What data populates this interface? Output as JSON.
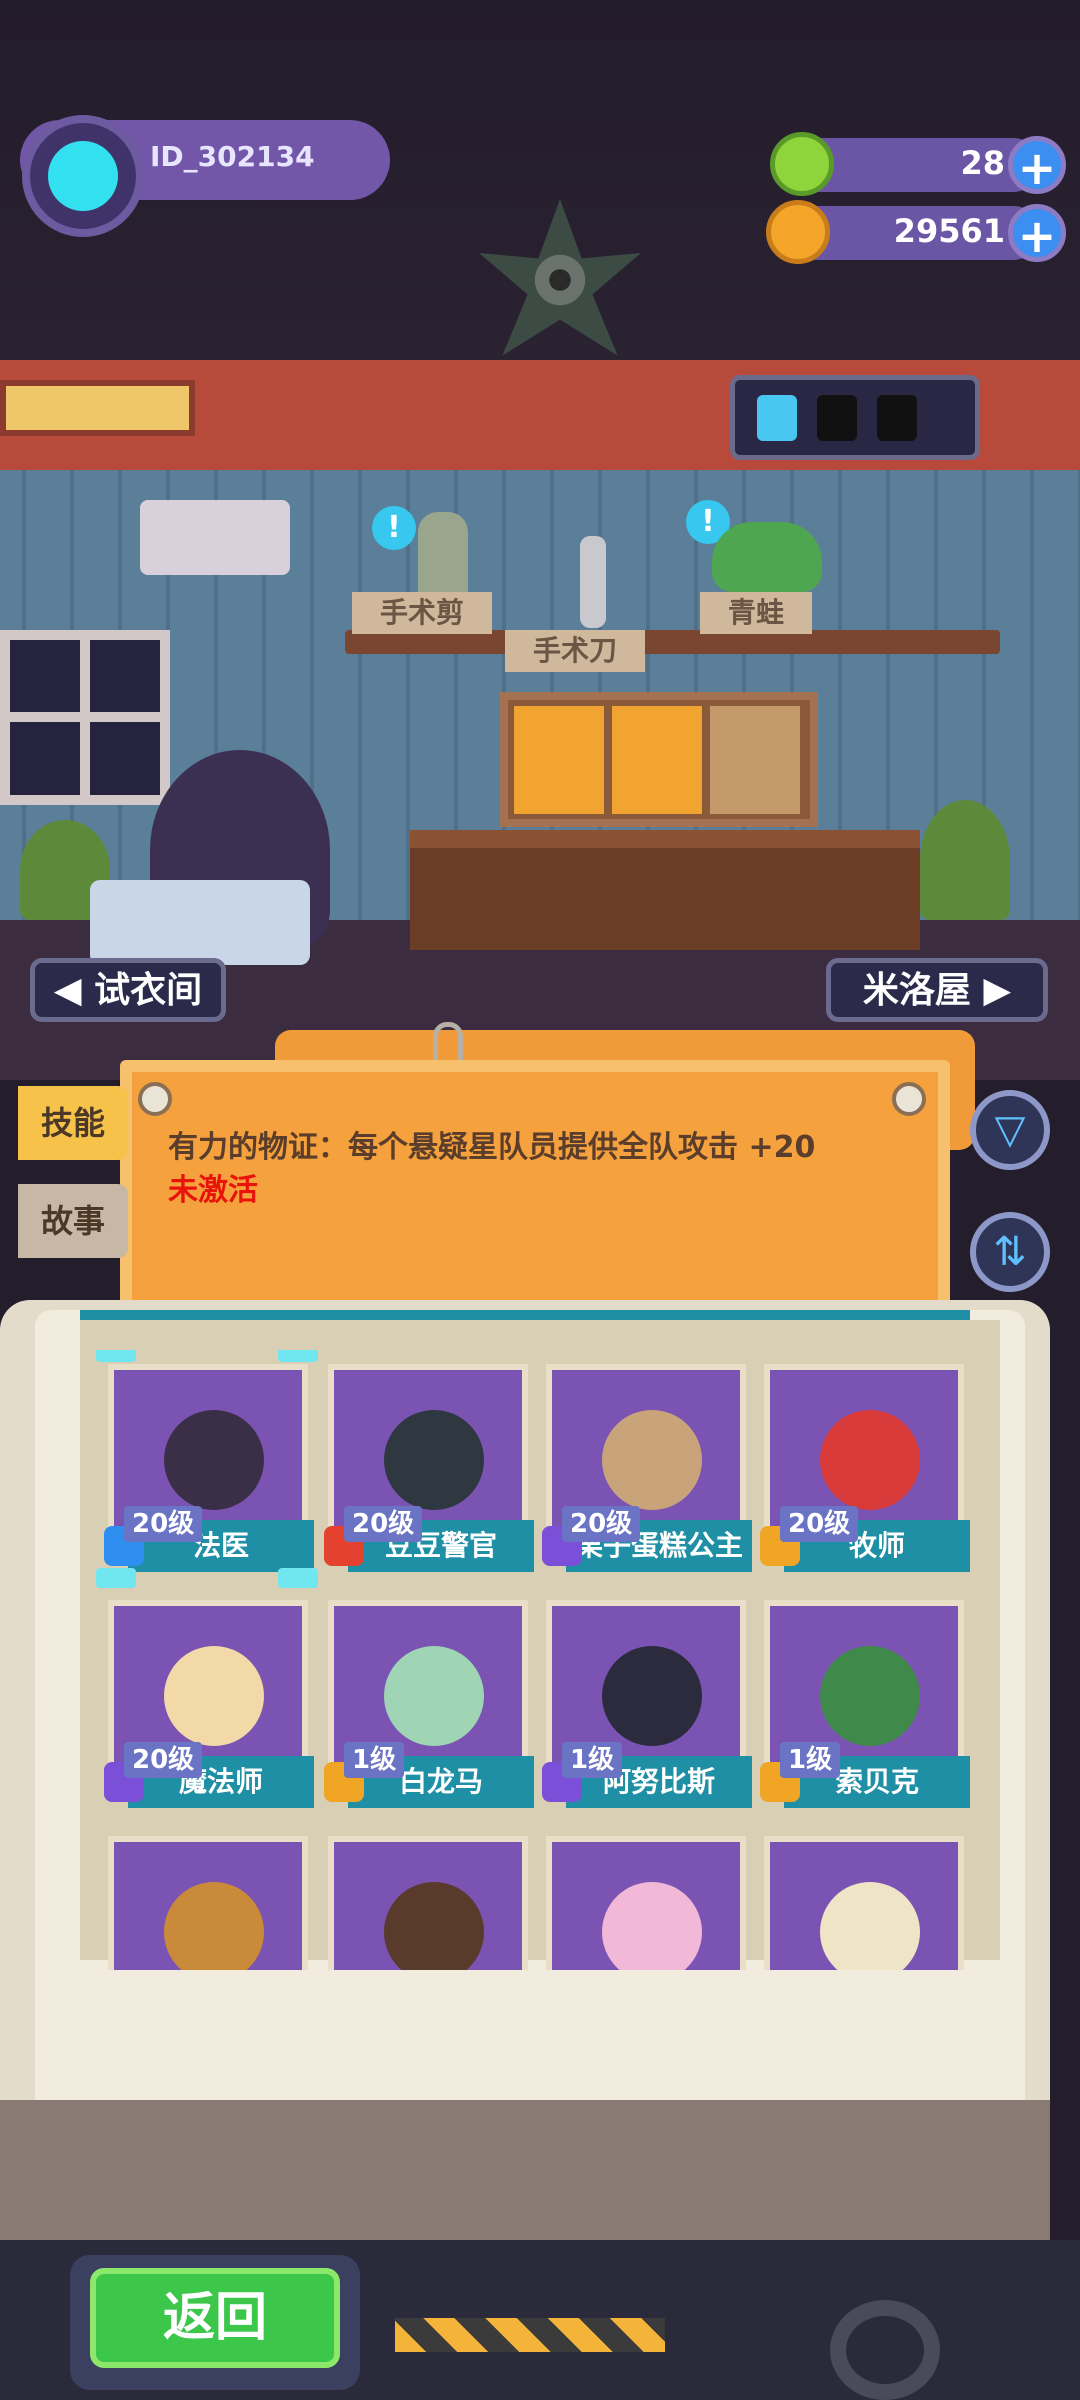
{
  "player": {
    "id": "ID_302134"
  },
  "resources": [
    {
      "name": "green-gem",
      "value": "28",
      "color": "#8fd43a"
    },
    {
      "name": "gold-coin",
      "value": "29561",
      "color": "#f4a52a"
    }
  ],
  "room": {
    "items": [
      "手术剪",
      "手术刀",
      "青蛙"
    ],
    "nav_left": "试衣间",
    "nav_right": "米洛屋"
  },
  "skill_panel": {
    "tabs": [
      "技能",
      "故事"
    ],
    "description": "有力的物证：每个悬疑星队员提供全队攻击 +20",
    "status": "未激活"
  },
  "characters": [
    {
      "level": "20级",
      "name": "法医",
      "emblem_color": "#2f8ff0",
      "face_color": "#3b2f47",
      "selected": true
    },
    {
      "level": "20级",
      "name": "豆豆警官",
      "emblem_color": "#e4412f",
      "face_color": "#2f3740",
      "selected": false
    },
    {
      "level": "20级",
      "name": "栗子蛋糕公主",
      "emblem_color": "#7b4fd8",
      "face_color": "#c9a47a",
      "selected": false
    },
    {
      "level": "20级",
      "name": "牧师",
      "emblem_color": "#f0a525",
      "face_color": "#d83a3a",
      "selected": false
    },
    {
      "level": "20级",
      "name": "魔法师",
      "emblem_color": "#7b4fd8",
      "face_color": "#f3d9a8",
      "selected": false
    },
    {
      "level": "1级",
      "name": "白龙马",
      "emblem_color": "#f0a525",
      "face_color": "#9fd4b5",
      "selected": false
    },
    {
      "level": "1级",
      "name": "阿努比斯",
      "emblem_color": "#7b4fd8",
      "face_color": "#2c2b3e",
      "selected": false
    },
    {
      "level": "1级",
      "name": "索贝克",
      "emblem_color": "#f0a525",
      "face_color": "#3f8a4a",
      "selected": false
    },
    {
      "level": "",
      "name": "",
      "emblem_color": "#7b4fd8",
      "face_color": "#c98a3a",
      "selected": false
    },
    {
      "level": "",
      "name": "",
      "emblem_color": "#7b4fd8",
      "face_color": "#5a3a2a",
      "selected": false
    },
    {
      "level": "",
      "name": "",
      "emblem_color": "#7b4fd8",
      "face_color": "#f2b8d8",
      "selected": false
    },
    {
      "level": "",
      "name": "",
      "emblem_color": "#7b4fd8",
      "face_color": "#efe4c6",
      "selected": false
    }
  ],
  "footer": {
    "back_label": "返回"
  }
}
